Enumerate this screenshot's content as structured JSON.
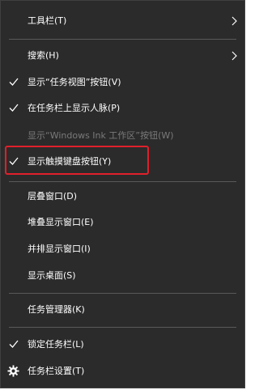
{
  "menu": {
    "items": [
      {
        "label": "工具栏(T)",
        "checked": false,
        "submenu": true,
        "disabled": false
      },
      {
        "label": "搜索(H)",
        "checked": false,
        "submenu": true,
        "disabled": false
      },
      {
        "label": "显示“任务视图”按钮(V)",
        "checked": true,
        "submenu": false,
        "disabled": false
      },
      {
        "label": "在任务栏上显示人脉(P)",
        "checked": true,
        "submenu": false,
        "disabled": false
      },
      {
        "label": "显示“Windows Ink 工作区”按钮(W)",
        "checked": false,
        "submenu": false,
        "disabled": true
      },
      {
        "label": "显示触摸键盘按钮(Y)",
        "checked": true,
        "submenu": false,
        "disabled": false,
        "highlighted": true
      },
      {
        "label": "层叠窗口(D)",
        "checked": false,
        "submenu": false,
        "disabled": false
      },
      {
        "label": "堆叠显示窗口(E)",
        "checked": false,
        "submenu": false,
        "disabled": false
      },
      {
        "label": "并排显示窗口(I)",
        "checked": false,
        "submenu": false,
        "disabled": false
      },
      {
        "label": "显示桌面(S)",
        "checked": false,
        "submenu": false,
        "disabled": false
      },
      {
        "label": "任务管理器(K)",
        "checked": false,
        "submenu": false,
        "disabled": false
      },
      {
        "label": "锁定任务栏(L)",
        "checked": true,
        "submenu": false,
        "disabled": false
      },
      {
        "label": "任务栏设置(T)",
        "checked": false,
        "submenu": false,
        "disabled": false,
        "icon": "gear-icon"
      }
    ]
  },
  "colors": {
    "menu_background": "#2b2b2b",
    "text": "#ffffff",
    "disabled_text": "#7a7a7a",
    "separator": "#595959",
    "highlight_border": "#e0202a"
  }
}
